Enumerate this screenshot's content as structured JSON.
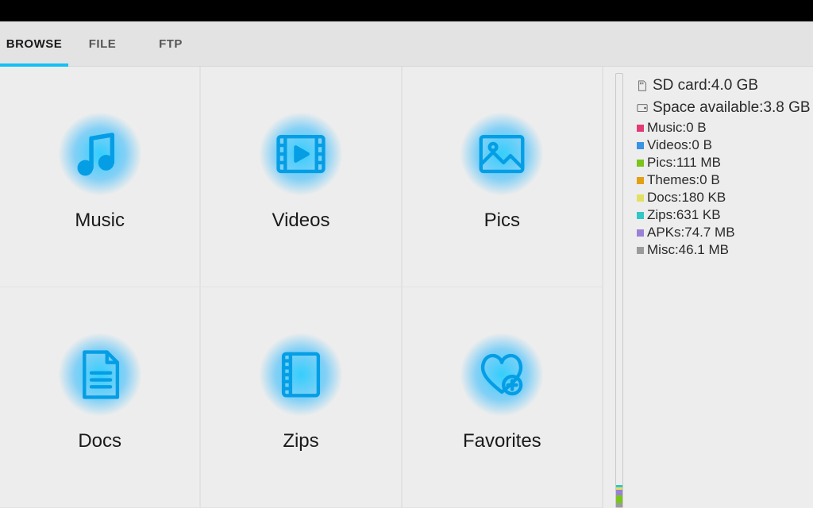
{
  "tabs": {
    "browse": "BROWSE",
    "file": "FILE",
    "ftp": "FTP"
  },
  "categories": {
    "music": "Music",
    "videos": "Videos",
    "pics": "Pics",
    "docs": "Docs",
    "zips": "Zips",
    "favorites": "Favorites"
  },
  "storage": {
    "sd_label": "SD card:",
    "sd_value": "4.0 GB",
    "avail_label": "Space available:",
    "avail_value": "3.8 GB"
  },
  "stats": {
    "music": {
      "label": "Music:",
      "value": "0 B",
      "color": "#e33a74"
    },
    "videos": {
      "label": "Videos:",
      "value": "0 B",
      "color": "#3a93e3"
    },
    "pics": {
      "label": "Pics:",
      "value": "111 MB",
      "color": "#7bc41c"
    },
    "themes": {
      "label": "Themes:",
      "value": "0 B",
      "color": "#e2a014"
    },
    "docs": {
      "label": "Docs:",
      "value": "180 KB",
      "color": "#e2e062"
    },
    "zips": {
      "label": "Zips:",
      "value": "631 KB",
      "color": "#34c6c6"
    },
    "apks": {
      "label": "APKs:",
      "value": "74.7 MB",
      "color": "#9b80d8"
    },
    "misc": {
      "label": "Misc:",
      "value": "46.1 MB",
      "color": "#9b9b9b"
    }
  }
}
